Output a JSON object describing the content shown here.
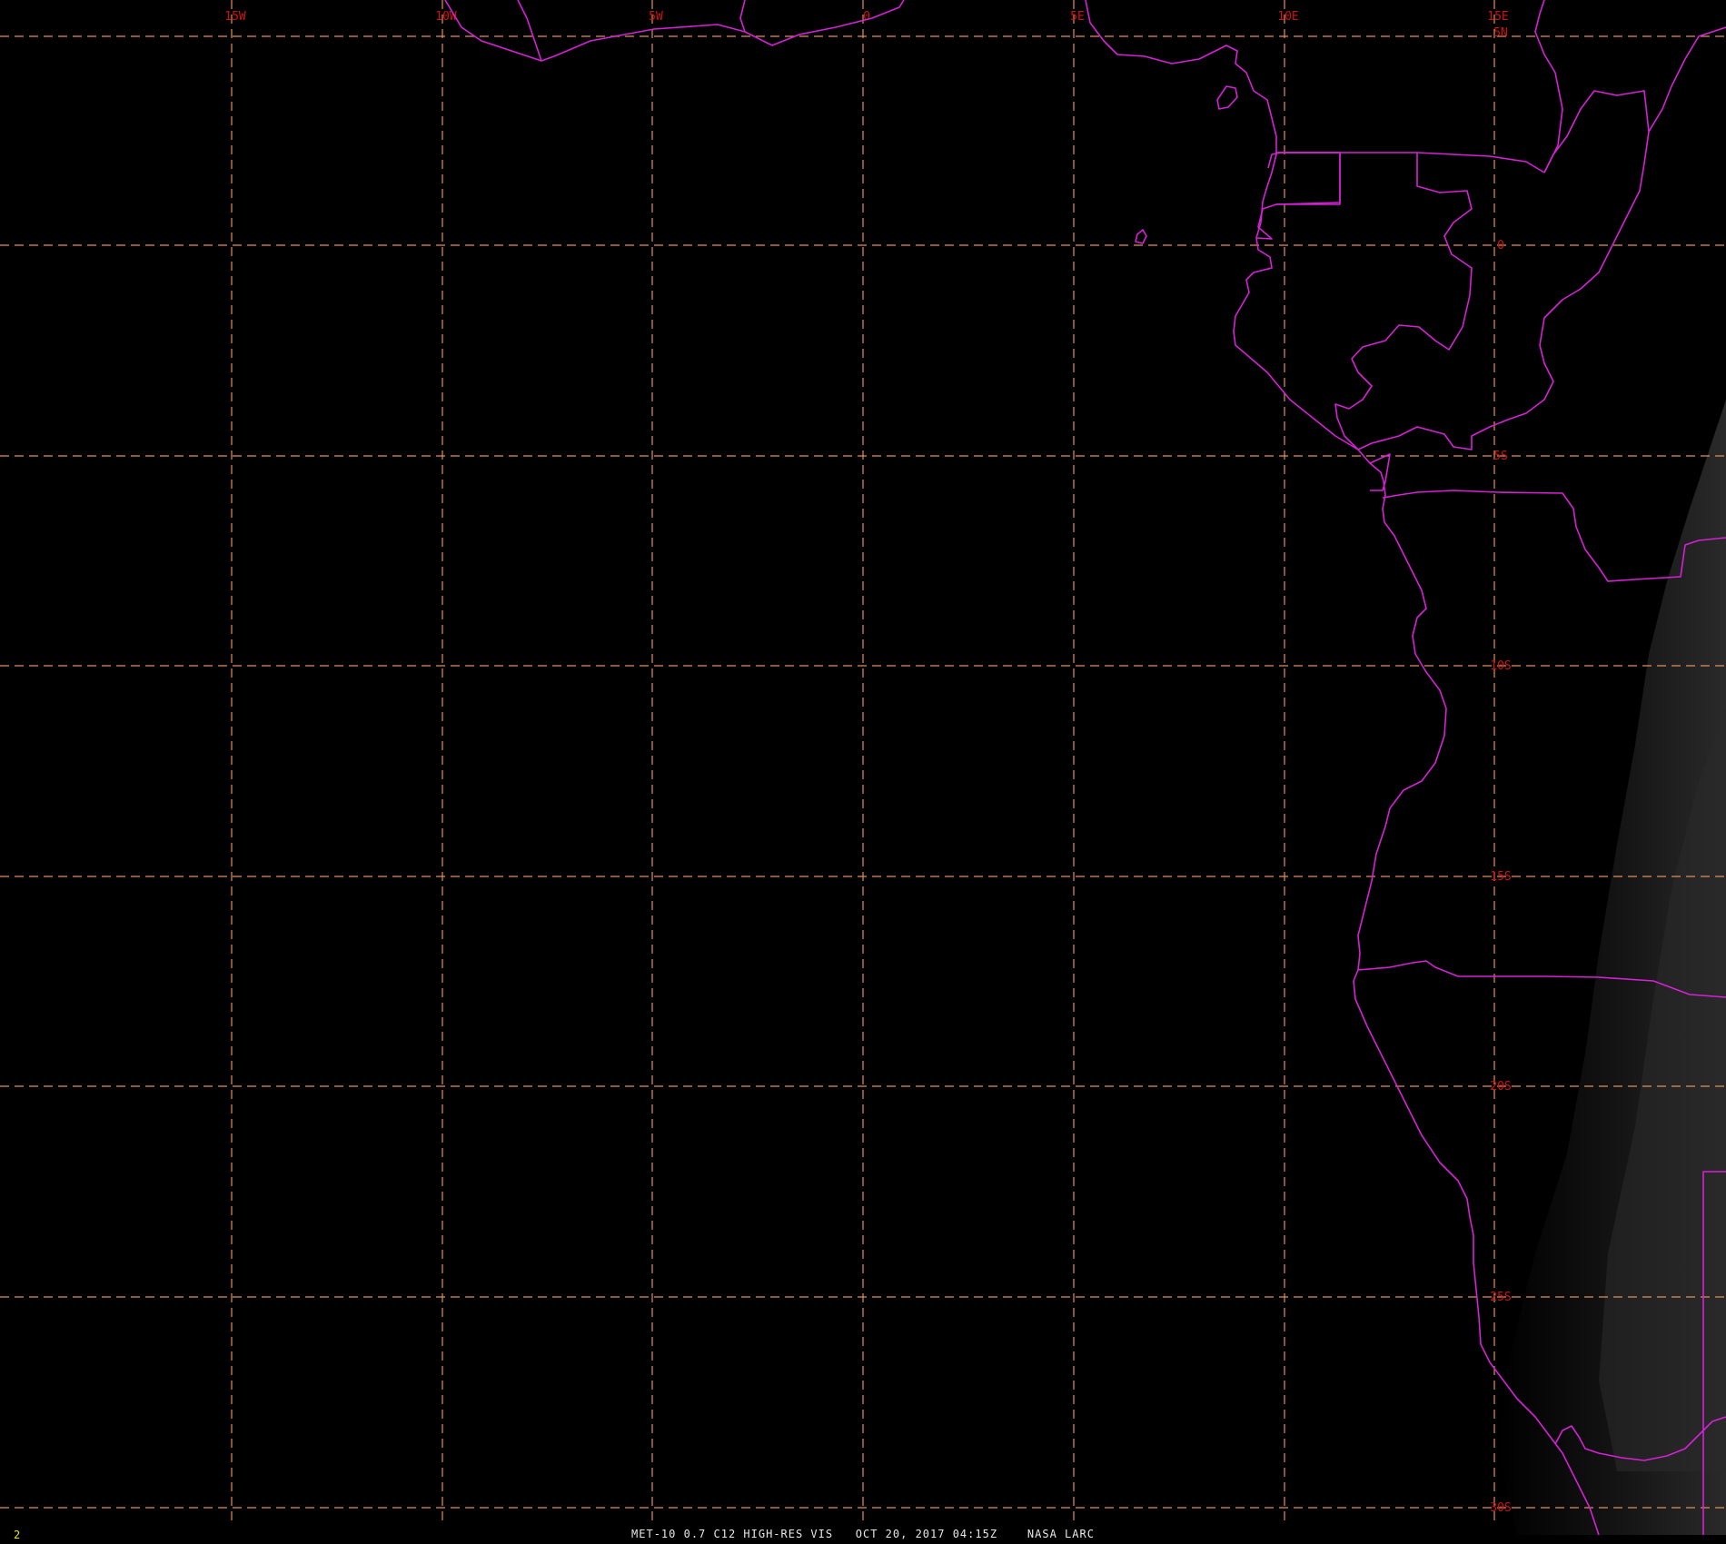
{
  "image": {
    "caption": "MET-10 0.7 C12 HIGH-RES VIS   OCT 20, 2017 04:15Z    NASA LARC",
    "frame_number": "2"
  },
  "grid": {
    "line_color": "#e0905a",
    "lon_labels": [
      "15W",
      "10W",
      "5W",
      "0",
      "5E",
      "10E",
      "15E"
    ],
    "lat_labels": [
      "5N",
      "0",
      "5S",
      "10S",
      "15S",
      "20S",
      "25S",
      "30S"
    ]
  },
  "colors": {
    "background": "#000000",
    "boundaries": "#d422d4",
    "grid_label": "#cc1414",
    "caption": "#e8e8e8",
    "frame_number": "#e6e600"
  }
}
